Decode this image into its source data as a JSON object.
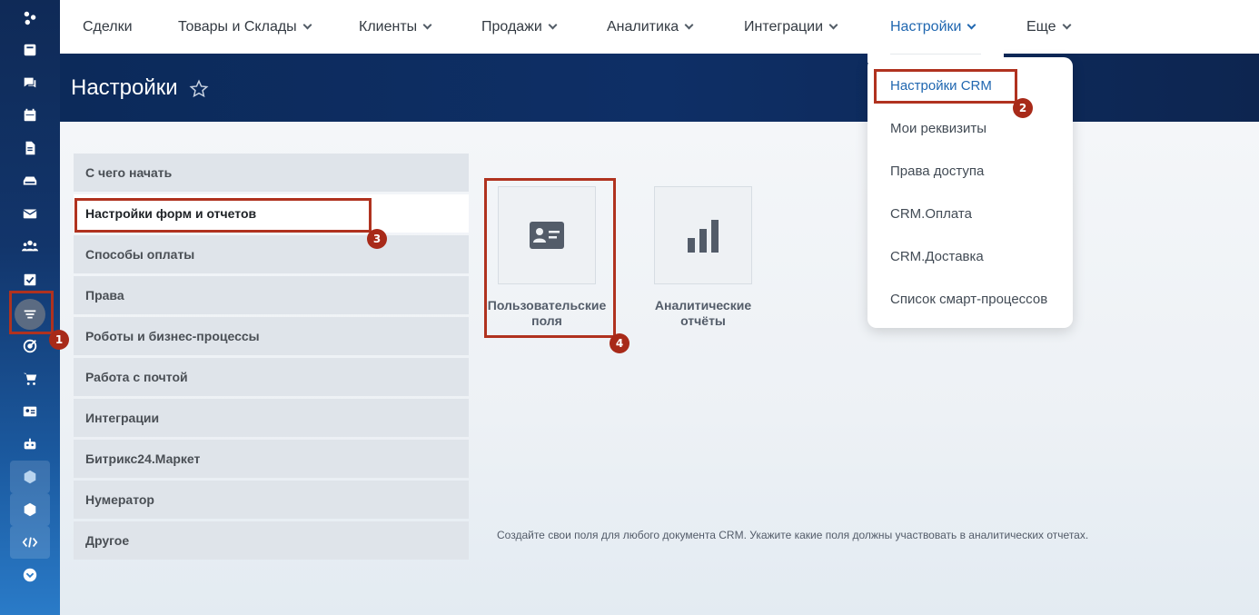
{
  "nav": {
    "items": [
      {
        "label": "Сделки",
        "has_chevron": false
      },
      {
        "label": "Товары и Склады",
        "has_chevron": true
      },
      {
        "label": "Клиенты",
        "has_chevron": true
      },
      {
        "label": "Продажи",
        "has_chevron": true
      },
      {
        "label": "Аналитика",
        "has_chevron": true
      },
      {
        "label": "Интеграции",
        "has_chevron": true
      },
      {
        "label": "Настройки",
        "has_chevron": true,
        "active": true
      },
      {
        "label": "Еще",
        "has_chevron": true
      }
    ]
  },
  "header": {
    "title": "Настройки",
    "star_icon": "star-outline-icon"
  },
  "sidebar_menu": {
    "items": [
      {
        "label": "С чего начать"
      },
      {
        "label": "Настройки форм и отчетов",
        "current": true
      },
      {
        "label": "Способы оплаты"
      },
      {
        "label": "Права"
      },
      {
        "label": "Роботы и бизнес-процессы"
      },
      {
        "label": "Работа с почтой"
      },
      {
        "label": "Интеграции"
      },
      {
        "label": "Битрикс24.Маркет"
      },
      {
        "label": "Нумератор"
      },
      {
        "label": "Другое"
      }
    ]
  },
  "tiles": [
    {
      "label_line1": "Пользовательские",
      "label_line2": "поля",
      "icon": "user-card-icon"
    },
    {
      "label_line1": "Аналитические",
      "label_line2": "отчёты",
      "icon": "bar-chart-icon"
    }
  ],
  "footer_note": "Создайте свои поля для любого документа CRM. Укажите какие поля должны участвовать в аналитических отчетах.",
  "dropdown": {
    "items": [
      {
        "label": "Настройки CRM",
        "selected": true
      },
      {
        "label": "Мои реквизиты"
      },
      {
        "label": "Права доступа"
      },
      {
        "label": "CRM.Оплата"
      },
      {
        "label": "CRM.Доставка"
      },
      {
        "label": "Список смарт-процессов"
      }
    ]
  },
  "annotations": [
    "1",
    "2",
    "3",
    "4"
  ],
  "colors": {
    "accent": "#2067b0",
    "annotation": "#b0321f",
    "header_band": "#0e2f66"
  }
}
